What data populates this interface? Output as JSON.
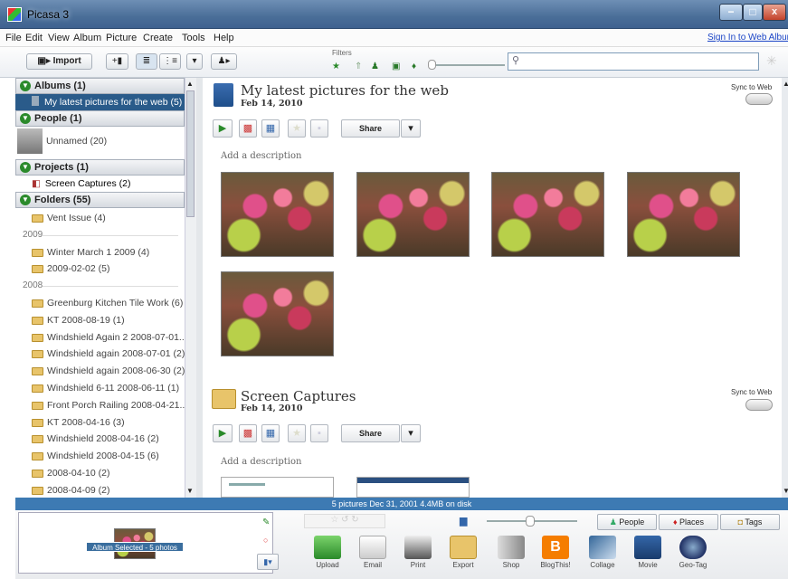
{
  "window": {
    "title": "Picasa 3",
    "min": "−",
    "max": "□",
    "close": "x"
  },
  "menu": {
    "items": [
      "File",
      "Edit",
      "View",
      "Album",
      "Picture",
      "Create",
      "Tools",
      "Help"
    ],
    "signin": "Sign In to Web Albums"
  },
  "toolbar": {
    "import": "Import",
    "filters_label": "Filters"
  },
  "sidebar": {
    "albums_header": "Albums (1)",
    "album_selected": "My latest pictures for the web (5)",
    "people_header": "People (1)",
    "people_item": "Unnamed (20)",
    "projects_header": "Projects (1)",
    "projects_item": "Screen Captures (2)",
    "folders_header": "Folders (55)",
    "folders": [
      {
        "label": "Vent Issue (4)"
      },
      {
        "year": "2009"
      },
      {
        "label": "Winter March 1 2009 (4)"
      },
      {
        "label": "2009-02-02 (5)"
      },
      {
        "year": "2008"
      },
      {
        "label": "Greenburg Kitchen Tile Work (6)"
      },
      {
        "label": "KT 2008-08-19 (1)"
      },
      {
        "label": "Windshield Again 2 2008-07-01..."
      },
      {
        "label": "Windshield again 2008-07-01 (2)"
      },
      {
        "label": "Windshield again 2008-06-30 (2)"
      },
      {
        "label": "Windshield 6-11 2008-06-11 (1)"
      },
      {
        "label": "Front Porch Railing 2008-04-21..."
      },
      {
        "label": "KT 2008-04-16 (3)"
      },
      {
        "label": "Windshield 2008-04-16 (2)"
      },
      {
        "label": "Windshield 2008-04-15 (6)"
      },
      {
        "label": "2008-04-10 (2)"
      },
      {
        "label": "2008-04-09 (2)"
      }
    ]
  },
  "album1": {
    "title": "My latest pictures for the web",
    "date": "Feb 14, 2010",
    "sync": "Sync to Web",
    "share": "Share",
    "add_description": "Add a description"
  },
  "album2": {
    "title": "Screen Captures",
    "date": "Feb 14, 2010",
    "sync": "Sync to Web",
    "share": "Share",
    "add_description": "Add a description"
  },
  "status": {
    "text": "5 pictures   Dec 31, 2001   4.4MB on disk"
  },
  "tray": {
    "label": "Album Selected - 5 photos"
  },
  "bottom": {
    "people": "People",
    "places": "Places",
    "tags": "Tags",
    "actions": [
      "Upload",
      "Email",
      "Print",
      "Export",
      "Shop",
      "BlogThis!",
      "Collage",
      "Movie",
      "Geo-Tag"
    ]
  },
  "colors": {
    "accent": "#3d7ab3",
    "title_bar": "#4a6e98",
    "selected": "#2a5b8a"
  }
}
